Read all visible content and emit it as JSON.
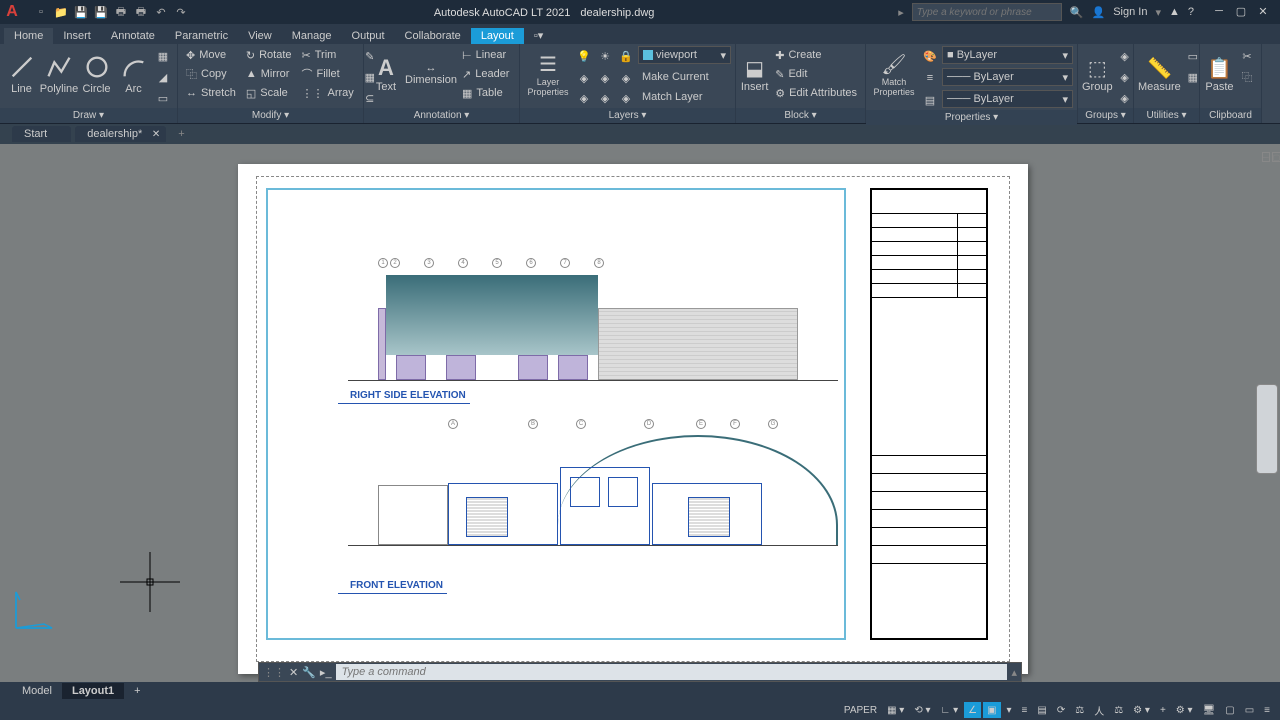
{
  "title": {
    "app": "Autodesk AutoCAD LT 2021",
    "file": "dealership.dwg"
  },
  "search": {
    "placeholder": "Type a keyword or phrase"
  },
  "signin": "Sign In",
  "menu": {
    "tabs": [
      "Home",
      "Insert",
      "Annotate",
      "Parametric",
      "View",
      "Manage",
      "Output",
      "Collaborate",
      "Layout"
    ]
  },
  "ribbon": {
    "draw": {
      "title": "Draw ▾",
      "line": "Line",
      "polyline": "Polyline",
      "circle": "Circle",
      "arc": "Arc"
    },
    "modify": {
      "title": "Modify ▾",
      "move": "Move",
      "rotate": "Rotate",
      "trim": "Trim",
      "copy": "Copy",
      "mirror": "Mirror",
      "fillet": "Fillet",
      "stretch": "Stretch",
      "scale": "Scale",
      "array": "Array"
    },
    "annotation": {
      "title": "Annotation ▾",
      "text": "Text",
      "dimension": "Dimension",
      "linear": "Linear",
      "leader": "Leader",
      "table": "Table"
    },
    "layers": {
      "title": "Layers ▾",
      "props": "Layer Properties",
      "current": "viewport",
      "make": "Make Current",
      "match": "Match Layer"
    },
    "block": {
      "title": "Block ▾",
      "insert": "Insert",
      "create": "Create",
      "edit": "Edit",
      "attr": "Edit Attributes"
    },
    "properties": {
      "title": "Properties ▾",
      "match": "Match Properties",
      "bylayer": "ByLayer"
    },
    "groups": {
      "title": "Groups ▾",
      "group": "Group"
    },
    "utilities": {
      "title": "Utilities ▾",
      "measure": "Measure"
    },
    "clipboard": {
      "title": "Clipboard",
      "paste": "Paste"
    }
  },
  "doctabs": {
    "start": "Start",
    "file": "dealership*"
  },
  "drawing": {
    "label1": "RIGHT SIDE ELEVATION",
    "label2": "FRONT ELEVATION",
    "bubbles1": [
      "1",
      "2",
      "3",
      "4",
      "5",
      "6",
      "7",
      "8"
    ],
    "bubbles2": [
      "A",
      "B",
      "C",
      "D",
      "E",
      "F",
      "G"
    ]
  },
  "cmd": {
    "placeholder": "Type a command"
  },
  "modeltabs": {
    "model": "Model",
    "layout": "Layout1"
  },
  "status": {
    "paper": "PAPER"
  }
}
